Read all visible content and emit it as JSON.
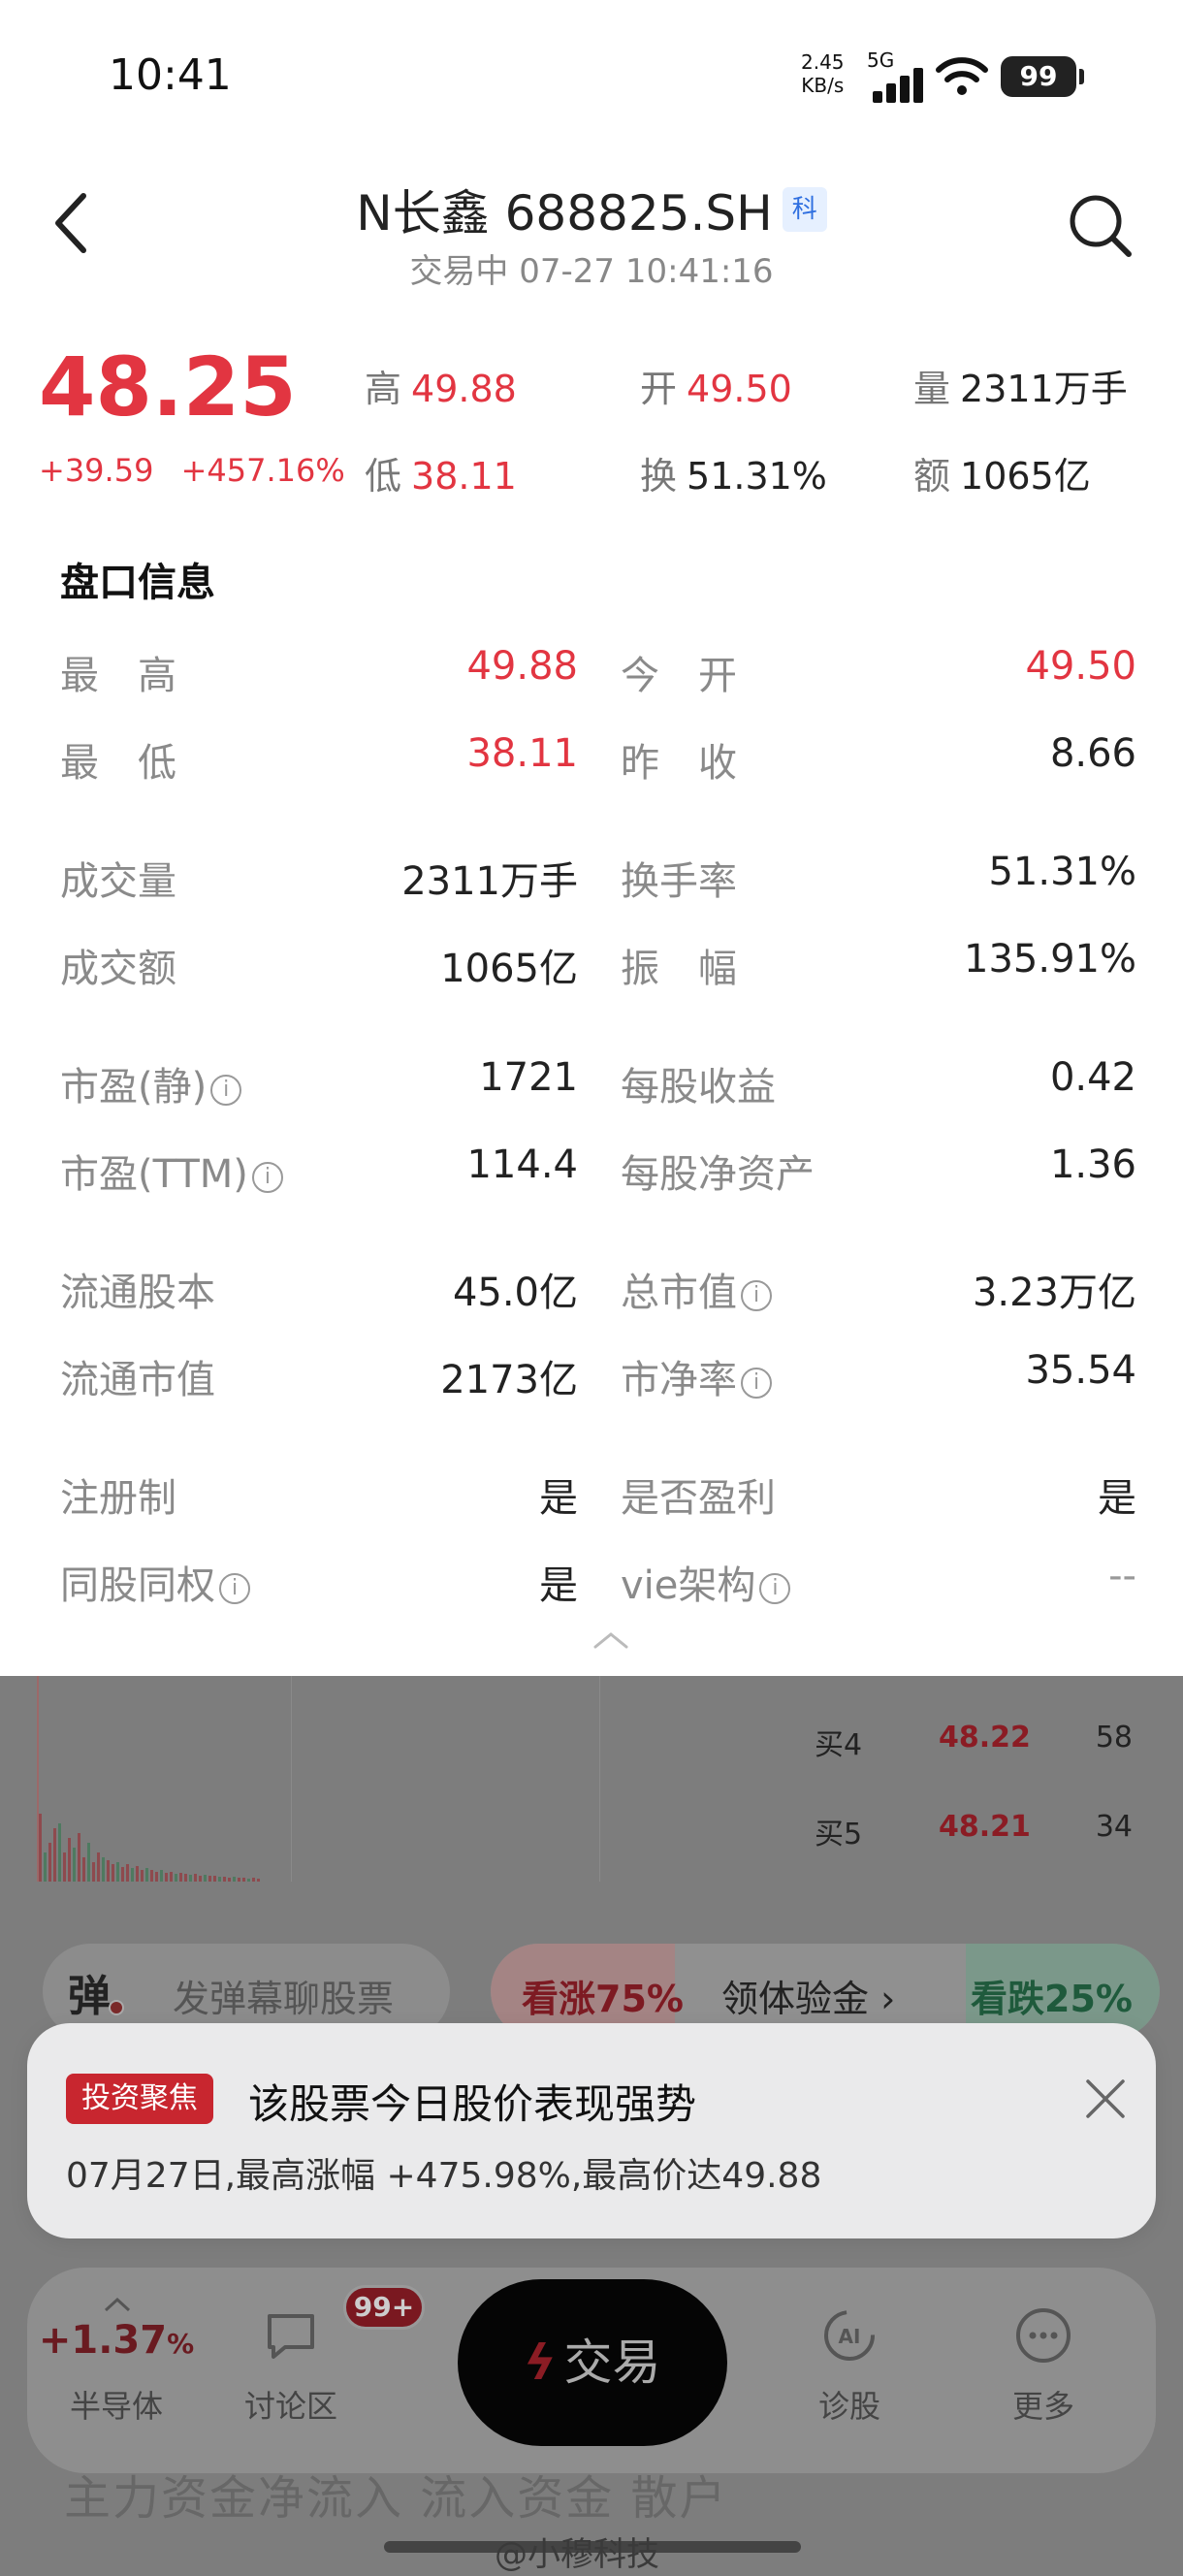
{
  "status_bar": {
    "time": "10:41",
    "net_speed": "2.45",
    "net_unit": "KB/s",
    "network": "5G",
    "battery": "99"
  },
  "header": {
    "stock_name": "N长鑫 688825.SH",
    "market_badge": "科",
    "trade_status": "交易中 07-27 10:41:16"
  },
  "quote": {
    "price": "48.25",
    "change": "+39.59",
    "change_pct": "+457.16%",
    "fields": [
      {
        "label": "高",
        "value": "49.88",
        "red": true
      },
      {
        "label": "开",
        "value": "49.50",
        "red": true
      },
      {
        "label": "量",
        "value": "2311万手",
        "red": false
      },
      {
        "label": "低",
        "value": "38.11",
        "red": true
      },
      {
        "label": "换",
        "value": "51.31%",
        "red": false
      },
      {
        "label": "额",
        "value": "1065亿",
        "red": false
      }
    ]
  },
  "info_panel": {
    "title": "盘口信息",
    "rows": [
      {
        "l1": "最　高",
        "v1": "49.88",
        "r1": true,
        "l2": "今　开",
        "v2": "49.50",
        "r2": true
      },
      {
        "l1": "最　低",
        "v1": "38.11",
        "r1": true,
        "l2": "昨　收",
        "v2": "8.66",
        "r2": false
      },
      {
        "l1": "成交量",
        "v1": "2311万手",
        "r1": false,
        "l2": "换手率",
        "v2": "51.31%",
        "r2": false
      },
      {
        "l1": "成交额",
        "v1": "1065亿",
        "r1": false,
        "l2": "振　幅",
        "v2": "135.91%",
        "r2": false
      },
      {
        "l1": "市盈(静)",
        "i1": true,
        "v1": "1721",
        "r1": false,
        "l2": "每股收益",
        "v2": "0.42",
        "r2": false
      },
      {
        "l1": "市盈(TTM)",
        "i1": true,
        "v1": "114.4",
        "r1": false,
        "l2": "每股净资产",
        "v2": "1.36",
        "r2": false
      },
      {
        "l1": "流通股本",
        "v1": "45.0亿",
        "r1": false,
        "l2": "总市值",
        "i2": true,
        "v2": "3.23万亿",
        "r2": false
      },
      {
        "l1": "流通市值",
        "v1": "2173亿",
        "r1": false,
        "l2": "市净率",
        "i2": true,
        "v2": "35.54",
        "r2": false
      },
      {
        "l1": "注册制",
        "v1": "是",
        "r1": false,
        "l2": "是否盈利",
        "v2": "是",
        "r2": false
      },
      {
        "l1": "同股同权",
        "i1": true,
        "v1": "是",
        "r1": false,
        "l2": "vie架构",
        "i2": true,
        "v2": "--",
        "r2": false
      }
    ]
  },
  "order_book": [
    {
      "level": "买4",
      "price": "48.22",
      "volume": "58"
    },
    {
      "level": "买5",
      "price": "48.21",
      "volume": "34"
    }
  ],
  "danmu": {
    "icon_text": "弹",
    "placeholder": "发弹幕聊股票"
  },
  "vote": {
    "up": "看涨75%",
    "middle": "领体验金",
    "down": "看跌25%"
  },
  "notice": {
    "tag": "投资聚焦",
    "headline": "该股票今日股价表现强势",
    "detail": "07月27日,最高涨幅 +475.98%,最高价达49.88"
  },
  "bottom_nav": {
    "sector_pct": "+1.37",
    "sector_pct_unit": "%",
    "sector_label": "半导体",
    "discuss_label": "讨论区",
    "discuss_badge": "99+",
    "trade_label": "交易",
    "diagnose_label": "诊股",
    "more_label": "更多"
  },
  "background_text": "主力资金净流入  流入资金  散户",
  "watermark": "@小穆科技",
  "colors": {
    "up_red": "#e23541",
    "badge_blue": "#2f6fe0"
  }
}
